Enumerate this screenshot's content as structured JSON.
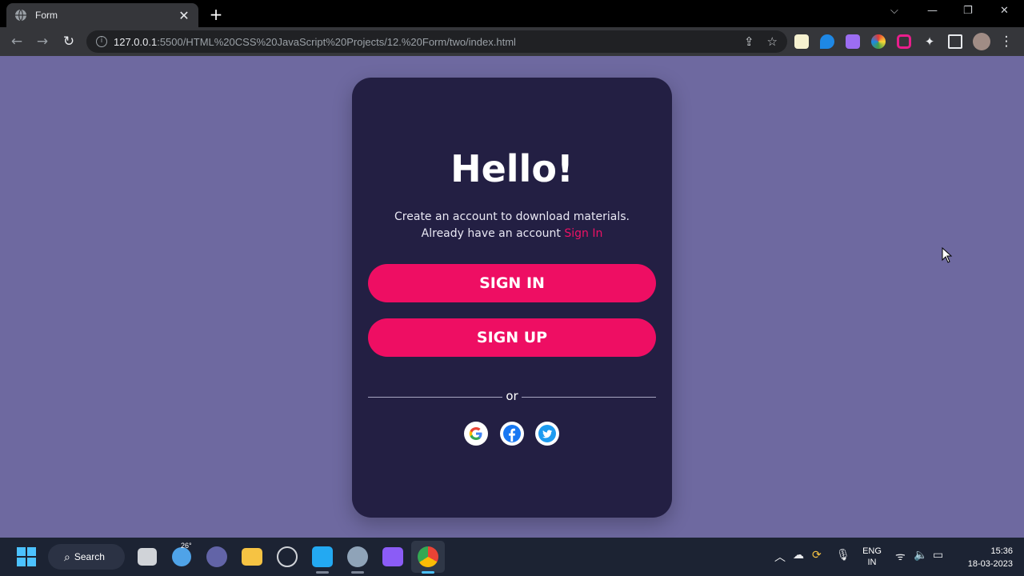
{
  "browser": {
    "tab_title": "Form",
    "close_tab": "✕",
    "new_tab": "+",
    "url_host": "127.0.0.1",
    "url_rest": ":5500/HTML%20CSS%20JavaScript%20Projects/12.%20Form/two/index.html"
  },
  "page": {
    "heading": "Hello!",
    "subtitle_line1": "Create an account to download materials.",
    "subtitle_line2": "Already have an account",
    "signin_link": "Sign In",
    "signin_button": "SIGN IN",
    "signup_button": "SIGN UP",
    "divider_text": "or"
  },
  "taskbar": {
    "search_label": "Search",
    "weather_badge": "26°",
    "lang_line1": "ENG",
    "lang_line2": "IN",
    "time": "15:36",
    "date": "18-03-2023"
  },
  "colors": {
    "page_bg": "#6e69a0",
    "card_bg": "#231f43",
    "accent": "#ee0e63"
  }
}
